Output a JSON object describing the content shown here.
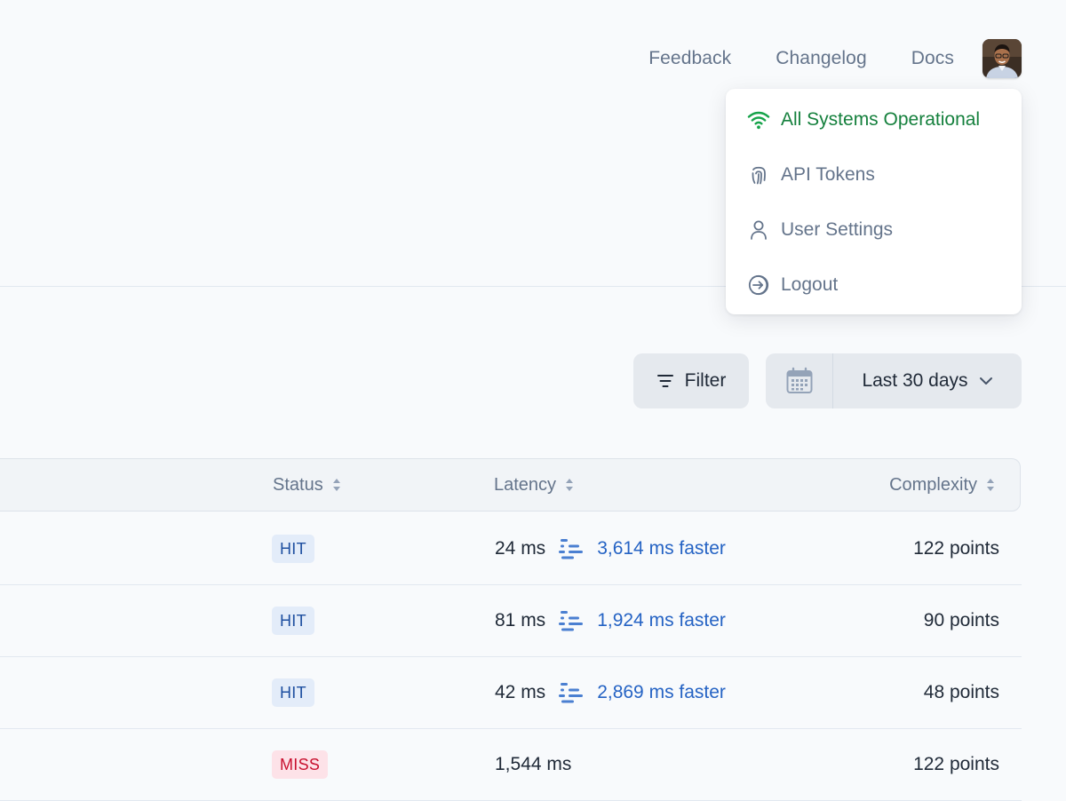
{
  "nav": {
    "links": [
      "Feedback",
      "Changelog",
      "Docs"
    ]
  },
  "menu": {
    "items": [
      {
        "label": "All Systems Operational",
        "icon": "wifi-icon"
      },
      {
        "label": "API Tokens",
        "icon": "fingerprint-icon"
      },
      {
        "label": "User Settings",
        "icon": "user-icon"
      },
      {
        "label": "Logout",
        "icon": "logout-icon"
      }
    ]
  },
  "controls": {
    "filter_label": "Filter",
    "date_range_label": "Last 30 days"
  },
  "table": {
    "columns": {
      "status": "Status",
      "latency": "Latency",
      "complexity": "Complexity"
    },
    "rows": [
      {
        "status": "HIT",
        "latency": "24 ms",
        "faster": "3,614 ms faster",
        "complexity": "122 points"
      },
      {
        "status": "HIT",
        "latency": "81 ms",
        "faster": "1,924 ms faster",
        "complexity": "90 points"
      },
      {
        "status": "HIT",
        "latency": "42 ms",
        "faster": "2,869 ms faster",
        "complexity": "48 points"
      },
      {
        "status": "MISS",
        "latency": "1,544 ms",
        "faster": "",
        "complexity": "122 points"
      }
    ]
  },
  "colors": {
    "hit_bg": "#e3ecf9",
    "hit_text": "#1e4fa0",
    "miss_bg": "#fde2e8",
    "miss_text": "#c8102e",
    "operational": "#15803d",
    "faster": "#2563c4"
  }
}
